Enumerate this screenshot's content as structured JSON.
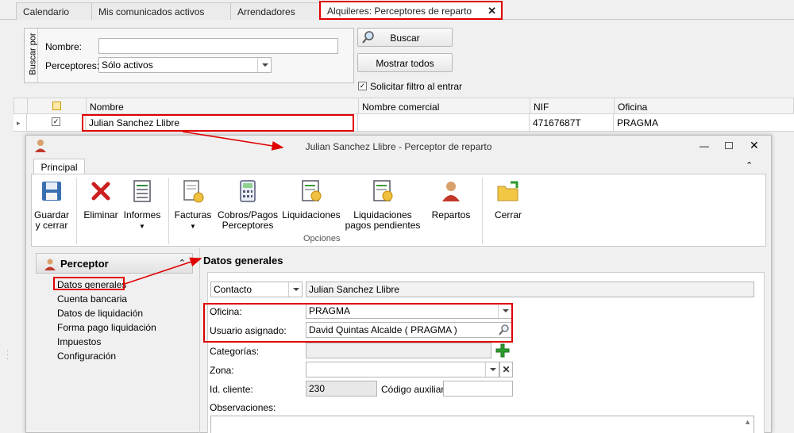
{
  "tabs": [
    {
      "label": "Calendario"
    },
    {
      "label": "Mis comunicados activos"
    },
    {
      "label": "Arrendadores"
    },
    {
      "label": "Alquileres: Perceptores de reparto",
      "active": true
    }
  ],
  "search": {
    "group_label": "Buscar por",
    "nombre_label": "Nombre:",
    "nombre_value": "",
    "perceptores_label": "Perceptores:",
    "perceptores_value": "Sólo activos",
    "buscar_button": "Buscar",
    "mostrar_todos_button": "Mostrar todos",
    "solicitar_filtro_label": "Solicitar filtro al entrar",
    "solicitar_filtro_checked": true
  },
  "grid": {
    "columns": [
      "Nombre",
      "Nombre comercial",
      "NIF",
      "Oficina"
    ],
    "rows": [
      {
        "nombre": "Julian Sanchez Llibre",
        "nombre_comercial": "",
        "nif": "47167687T",
        "oficina": "PRAGMA",
        "checked": true
      }
    ]
  },
  "dialog": {
    "title": "Julian Sanchez Llibre - Perceptor de reparto",
    "ribbon_tab": "Principal",
    "buttons": {
      "guardar": "Guardar\ny cerrar",
      "eliminar": "Eliminar",
      "informes": "Informes",
      "facturas": "Facturas",
      "cobros": "Cobros/Pagos\nPerceptores",
      "liquidaciones": "Liquidaciones",
      "liq_pendientes": "Liquidaciones\npagos pendientes",
      "repartos": "Repartos",
      "cerrar": "Cerrar"
    },
    "group_label": "Opciones",
    "side": {
      "header": "Perceptor",
      "items": [
        "Datos generales",
        "Cuenta bancaria",
        "Datos de liquidación",
        "Forma pago liquidación",
        "Impuestos",
        "Configuración"
      ]
    },
    "section_title": "Datos generales",
    "form": {
      "contacto_type": "Contacto",
      "contacto_value": "Julian Sanchez Llibre",
      "oficina_label": "Oficina:",
      "oficina_value": "PRAGMA",
      "usuario_label": "Usuario asignado:",
      "usuario_value": "David Quintas Alcalde ( PRAGMA )",
      "categorias_label": "Categorías:",
      "categorias_value": "",
      "zona_label": "Zona:",
      "zona_value": "",
      "id_cliente_label": "Id. cliente:",
      "id_cliente_value": "230",
      "codigo_aux_label": "Código auxiliar:",
      "codigo_aux_value": "",
      "observaciones_label": "Observaciones:"
    }
  },
  "colors": {
    "highlight": "#e00000",
    "add_green": "#2e9e2e"
  }
}
